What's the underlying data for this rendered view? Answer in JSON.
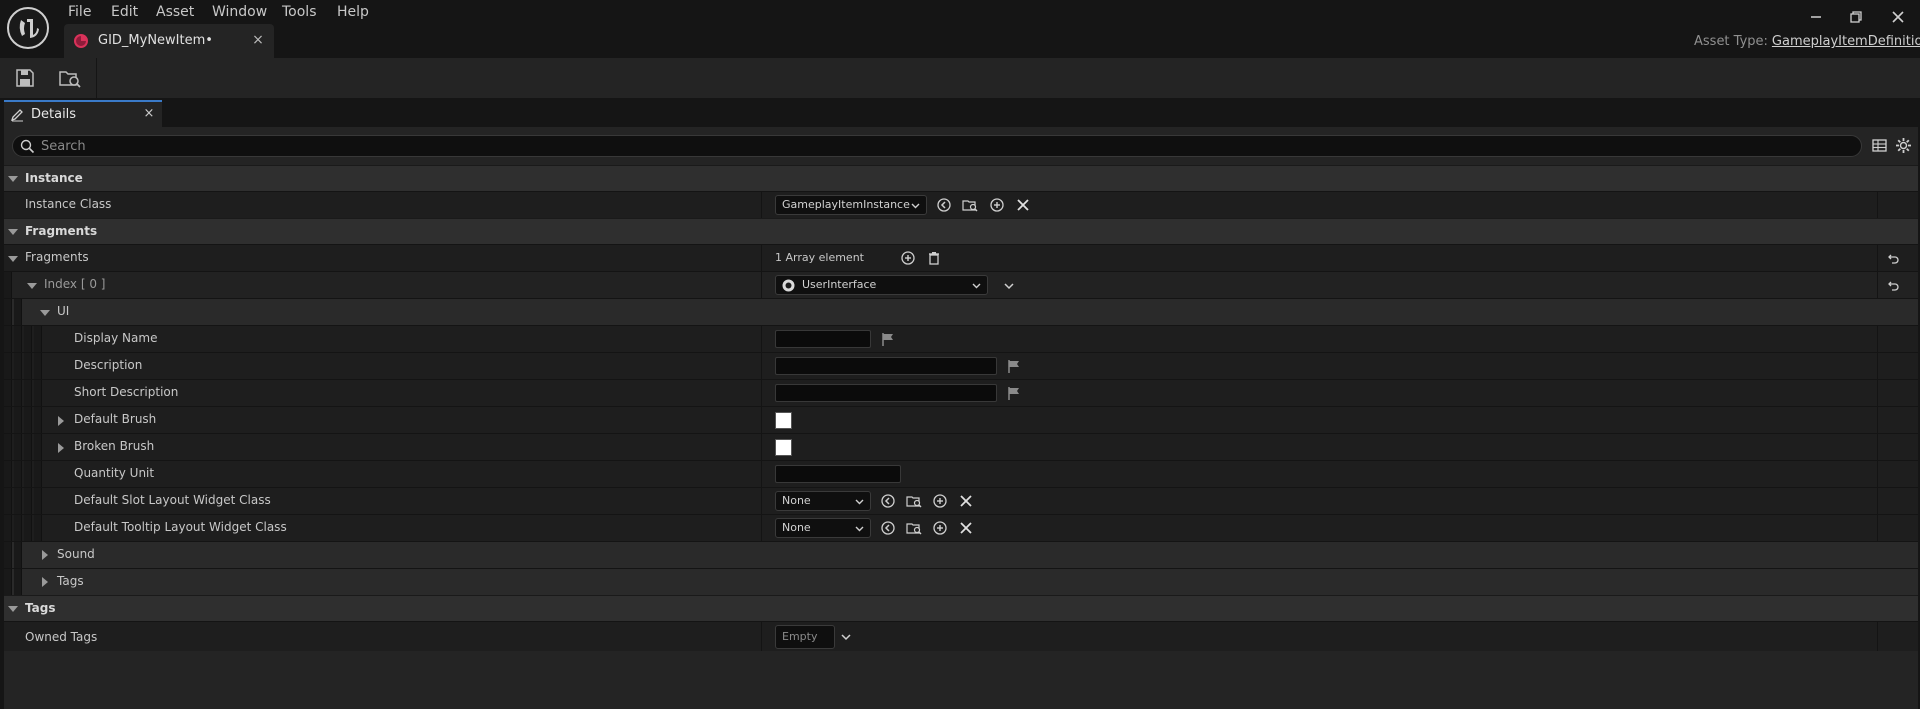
{
  "menu": [
    "File",
    "Edit",
    "Asset",
    "Window",
    "Tools",
    "Help"
  ],
  "tab": {
    "title": "GID_MyNewItem•",
    "close": "×"
  },
  "asset_type": {
    "label": "Asset Type:",
    "value": "GameplayItemDefinition"
  },
  "details": {
    "tab_label": "Details",
    "close": "×"
  },
  "search": {
    "placeholder": "Search",
    "value": ""
  },
  "sections": {
    "instance": {
      "label": "Instance",
      "instance_class_label": "Instance Class",
      "instance_class_value": "GameplayItemInstance"
    },
    "fragments": {
      "label": "Fragments",
      "fragments_label": "Fragments",
      "array_count": "1 Array element",
      "index_label": "Index [ 0 ]",
      "index_value": "UserInterface",
      "ui": {
        "label": "UI",
        "display_name": "Display Name",
        "description": "Description",
        "short_description": "Short Description",
        "default_brush": "Default Brush",
        "broken_brush": "Broken Brush",
        "quantity_unit": "Quantity Unit",
        "slot_layout_label": "Default Slot Layout Widget Class",
        "slot_layout_value": "None",
        "tooltip_layout_label": "Default Tooltip Layout Widget Class",
        "tooltip_layout_value": "None"
      },
      "sound": "Sound",
      "tags": "Tags"
    },
    "tags": {
      "label": "Tags",
      "owned_tags_label": "Owned Tags",
      "owned_tags_value": "Empty"
    }
  },
  "colors": {
    "accent": "#3a7ac8",
    "tab_icon": "#d9325a",
    "swatch": "#ffffff"
  }
}
